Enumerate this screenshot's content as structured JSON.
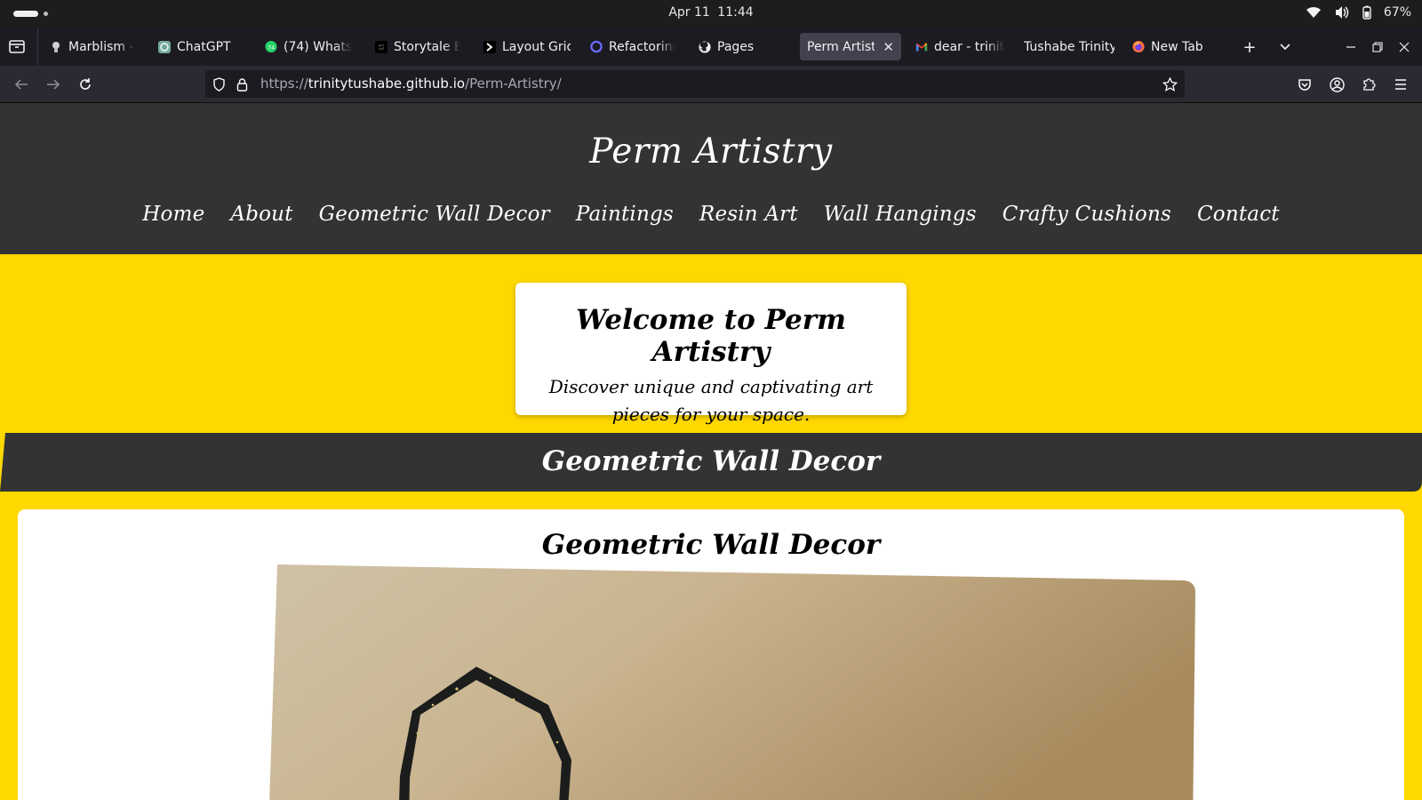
{
  "os": {
    "date": "Apr 11",
    "time": "11:44",
    "battery": "67%",
    "icons": [
      "wifi-icon",
      "volume-icon",
      "battery-icon"
    ]
  },
  "browser": {
    "tabs": [
      {
        "label": "Marblism - L",
        "icon": "marblism-favicon"
      },
      {
        "label": "ChatGPT",
        "icon": "chatgpt-favicon"
      },
      {
        "label": "(74) WhatsA",
        "icon": "whatsapp-favicon",
        "badge": "74"
      },
      {
        "label": "Storytale Br",
        "icon": "storytale-favicon"
      },
      {
        "label": "Layout Grid",
        "icon": "layout-grid-favicon"
      },
      {
        "label": "Refactoring",
        "icon": "refactoring-favicon"
      },
      {
        "label": "Pages",
        "icon": "github-favicon"
      },
      {
        "label": "Perm Artistry",
        "icon": "none",
        "active": true
      },
      {
        "label": "dear - trinity",
        "icon": "gmail-favicon"
      },
      {
        "label": "Tushabe Trinity",
        "icon": "none"
      },
      {
        "label": "New Tab",
        "icon": "firefox-favicon"
      }
    ],
    "url": {
      "scheme": "https://",
      "host": "trinitytushabe.github.io",
      "path": "/Perm-Artistry/"
    }
  },
  "site": {
    "title": "Perm Artistry",
    "nav": [
      "Home",
      "About",
      "Geometric Wall Decor",
      "Paintings",
      "Resin Art",
      "Wall Hangings",
      "Crafty Cushions",
      "Contact"
    ],
    "welcome": {
      "heading": "Welcome to Perm Artistry",
      "tagline": "Discover unique and captivating art pieces for your space."
    },
    "section_heading": "Geometric Wall Decor",
    "card_heading": "Geometric Wall Decor",
    "colors": {
      "page_bg": "#ffd800",
      "header_bg": "#333333",
      "card_bg": "#ffffff"
    }
  }
}
